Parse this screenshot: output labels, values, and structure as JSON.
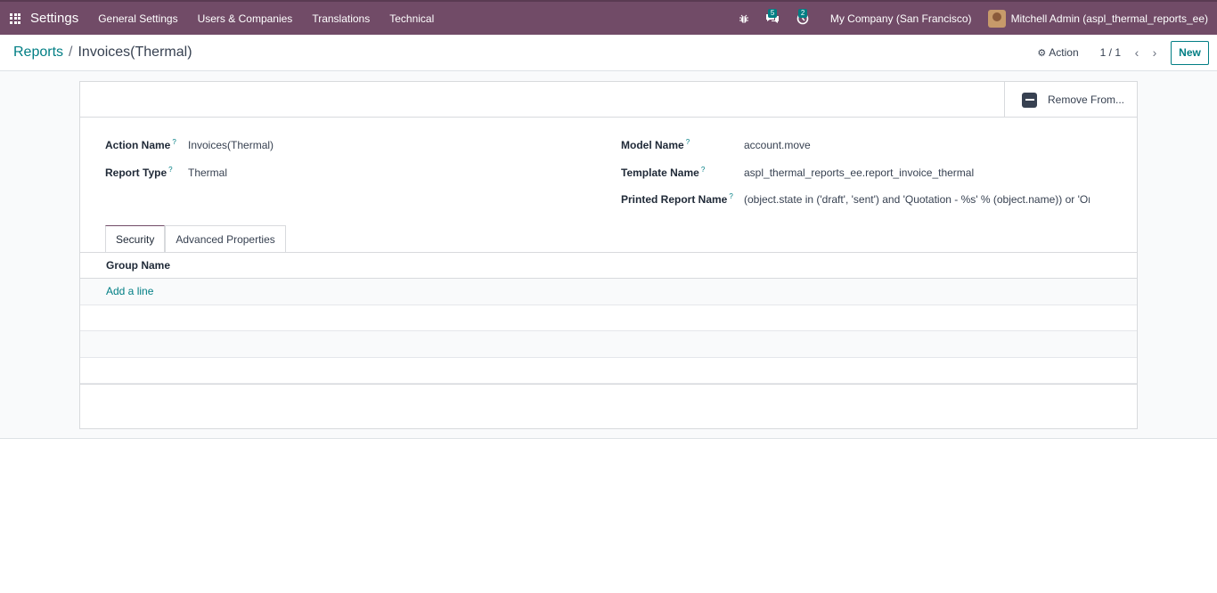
{
  "navbar": {
    "brand": "Settings",
    "menu": [
      "General Settings",
      "Users & Companies",
      "Translations",
      "Technical"
    ],
    "messages_count": "5",
    "activities_count": "2",
    "company": "My Company (San Francisco)",
    "user": "Mitchell Admin (aspl_thermal_reports_ee)"
  },
  "breadcrumb": {
    "parent": "Reports",
    "separator": "/",
    "current": "Invoices(Thermal)"
  },
  "control": {
    "action_label": "Action",
    "pager": "1 / 1",
    "new_label": "New"
  },
  "statusbar": {
    "remove_label": "Remove From..."
  },
  "fields": {
    "action_name": {
      "label": "Action Name",
      "value": "Invoices(Thermal)"
    },
    "report_type": {
      "label": "Report Type",
      "value": "Thermal"
    },
    "model_name": {
      "label": "Model Name",
      "value": "account.move"
    },
    "template_name": {
      "label": "Template Name",
      "value": "aspl_thermal_reports_ee.report_invoice_thermal"
    },
    "printed_report_name": {
      "label": "Printed Report Name",
      "value": "(object.state in ('draft', 'sent') and 'Quotation - %s' % (object.name)) or 'Order - %s' % (object.name)"
    },
    "help_marker": "?"
  },
  "tabs": [
    {
      "label": "Security",
      "active": true
    },
    {
      "label": "Advanced Properties",
      "active": false
    }
  ],
  "table": {
    "header": "Group Name",
    "add_line": "Add a line"
  },
  "colors": {
    "navbar": "#714b67",
    "accent": "#017e84"
  }
}
